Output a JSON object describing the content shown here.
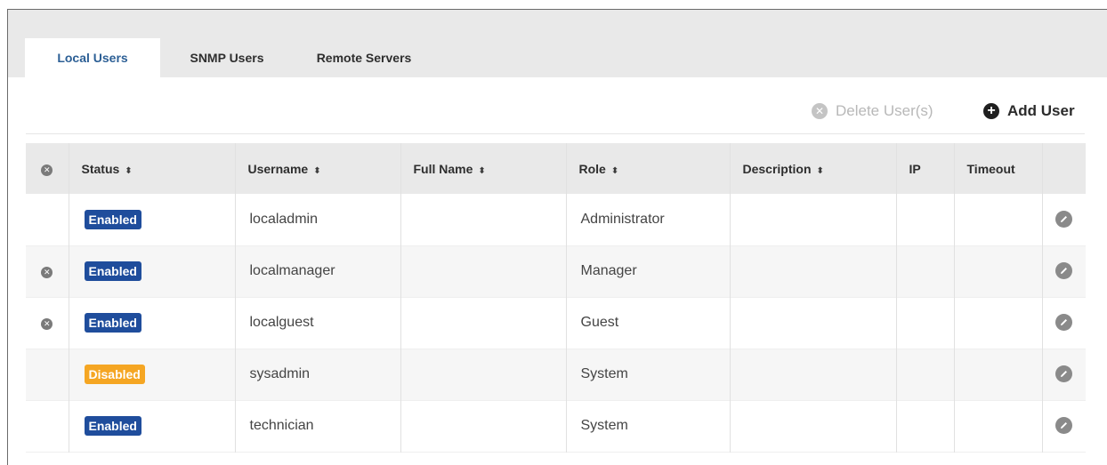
{
  "tabs": [
    {
      "label": "Local Users",
      "active": true
    },
    {
      "label": "SNMP Users",
      "active": false
    },
    {
      "label": "Remote Servers",
      "active": false
    }
  ],
  "toolbar": {
    "delete_label": "Delete User(s)",
    "delete_icon": "remove-circle-icon",
    "add_label": "Add User",
    "add_icon": "plus-circle-icon"
  },
  "table": {
    "columns": [
      "Status",
      "Username",
      "Full Name",
      "Role",
      "Description",
      "IP",
      "Timeout"
    ],
    "rows": [
      {
        "status": "Enabled",
        "username": "localadmin",
        "full_name": "",
        "role": "Administrator",
        "description": "",
        "ip": "",
        "timeout": ""
      },
      {
        "status": "Enabled",
        "username": "localmanager",
        "full_name": "",
        "role": "Manager",
        "description": "",
        "ip": "",
        "timeout": ""
      },
      {
        "status": "Enabled",
        "username": "localguest",
        "full_name": "",
        "role": "Guest",
        "description": "",
        "ip": "",
        "timeout": ""
      },
      {
        "status": "Disabled",
        "username": "sysadmin",
        "full_name": "",
        "role": "System",
        "description": "",
        "ip": "",
        "timeout": ""
      },
      {
        "status": "Enabled",
        "username": "technician",
        "full_name": "",
        "role": "System",
        "description": "",
        "ip": "",
        "timeout": ""
      }
    ]
  },
  "colors": {
    "enabled_badge": "#1f4d9c",
    "disabled_badge": "#f5a623",
    "active_tab_text": "#2c5f95",
    "header_bg": "#e9e9e9"
  }
}
